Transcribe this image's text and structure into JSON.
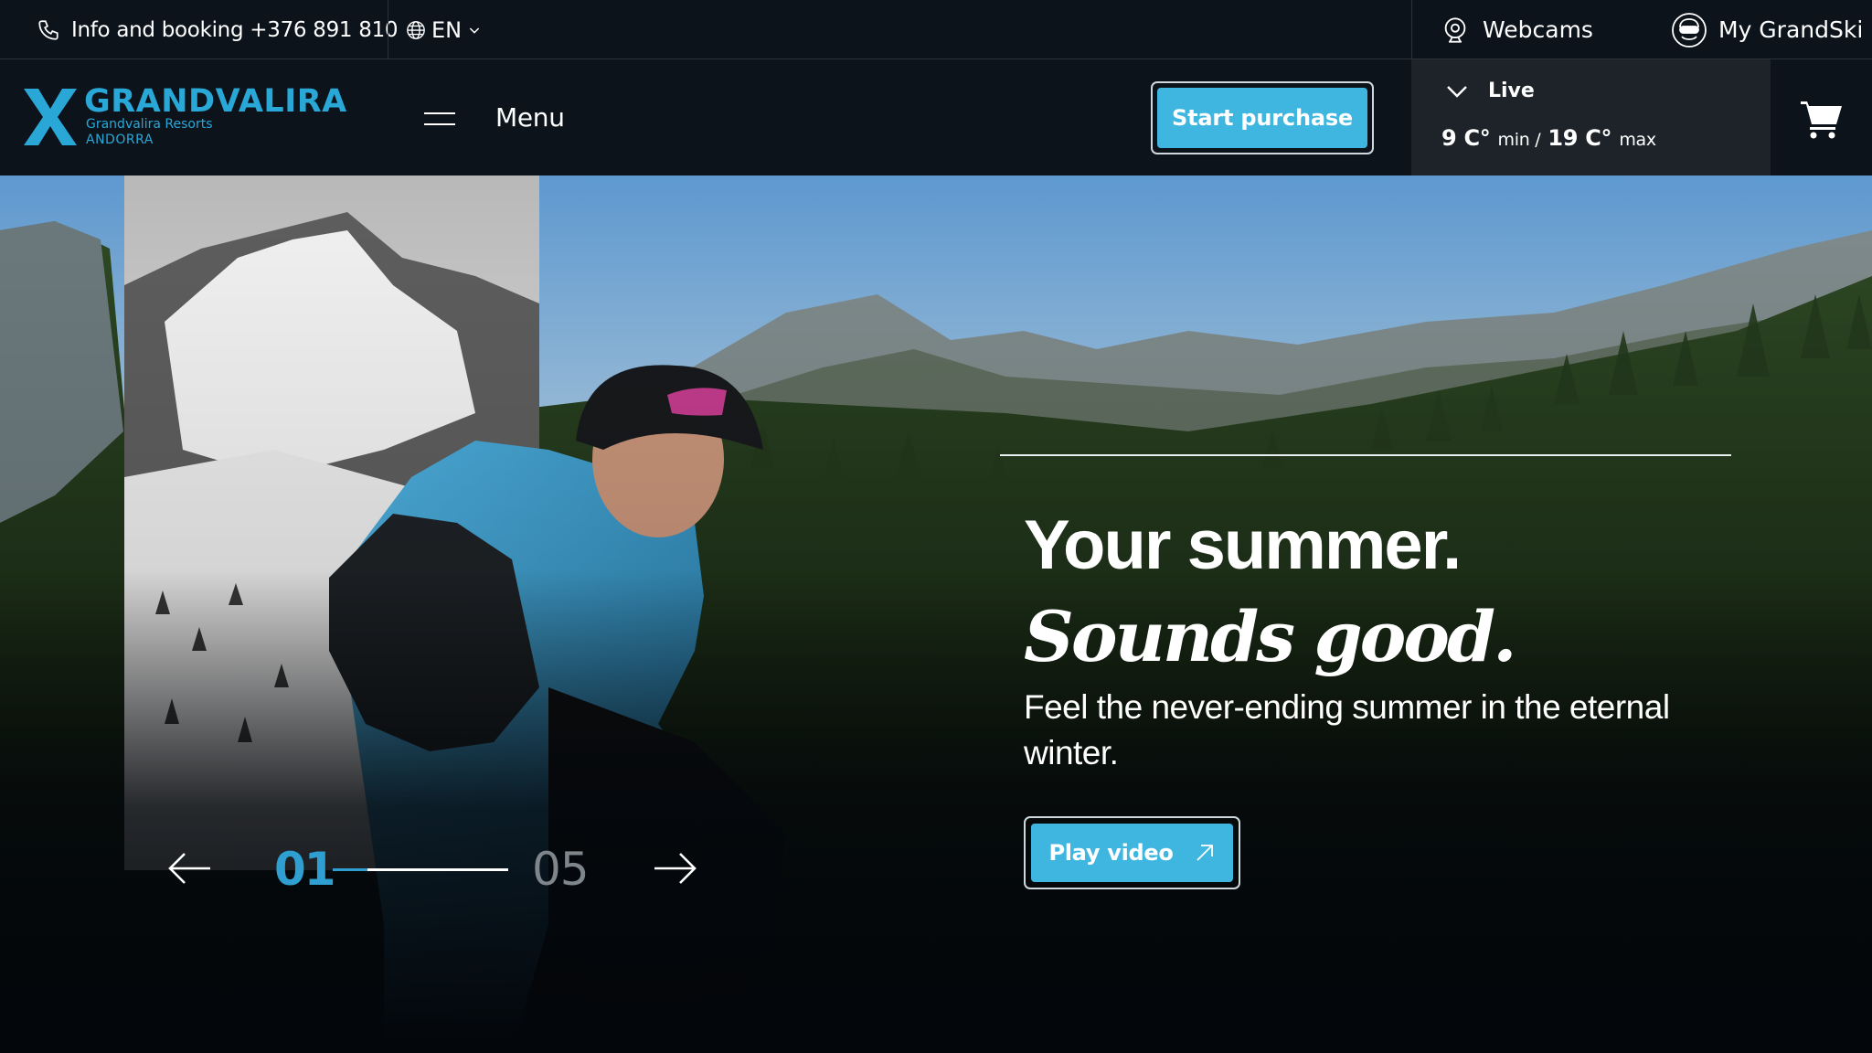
{
  "topbar": {
    "phone_label": "Info and booking +376 891 810",
    "language": "EN",
    "webcams_label": "Webcams",
    "account_label": "My GrandSki"
  },
  "header": {
    "logo": {
      "title": "GRANDVALIRA",
      "subtitle": "Grandvalira Resorts",
      "location": "ANDORRA"
    },
    "menu_label": "Menu",
    "start_purchase_label": "Start purchase",
    "weather": {
      "live_label": "Live",
      "min_value": "9 C°",
      "min_label": "min /",
      "max_value": "19 C°",
      "max_label": "max"
    }
  },
  "hero": {
    "headline_plain": "Your summer.",
    "headline_emphasis": "Sounds good.",
    "subline": "Feel the never-ending summer in the eternal winter.",
    "play_label": "Play video",
    "slider": {
      "current": "01",
      "total": "05",
      "progress": 0.2
    }
  },
  "colors": {
    "brand_blue": "#29a8d8",
    "button_blue": "#3fb6e0",
    "bar_bg": "#0c131b",
    "panel_bg": "#1d2329"
  },
  "icons": [
    "phone-icon",
    "globe-icon",
    "chevron-down-icon",
    "webcam-icon",
    "user-avatar-icon",
    "menu-icon",
    "cart-icon",
    "external-arrow-icon",
    "arrow-left-icon",
    "arrow-right-icon"
  ]
}
